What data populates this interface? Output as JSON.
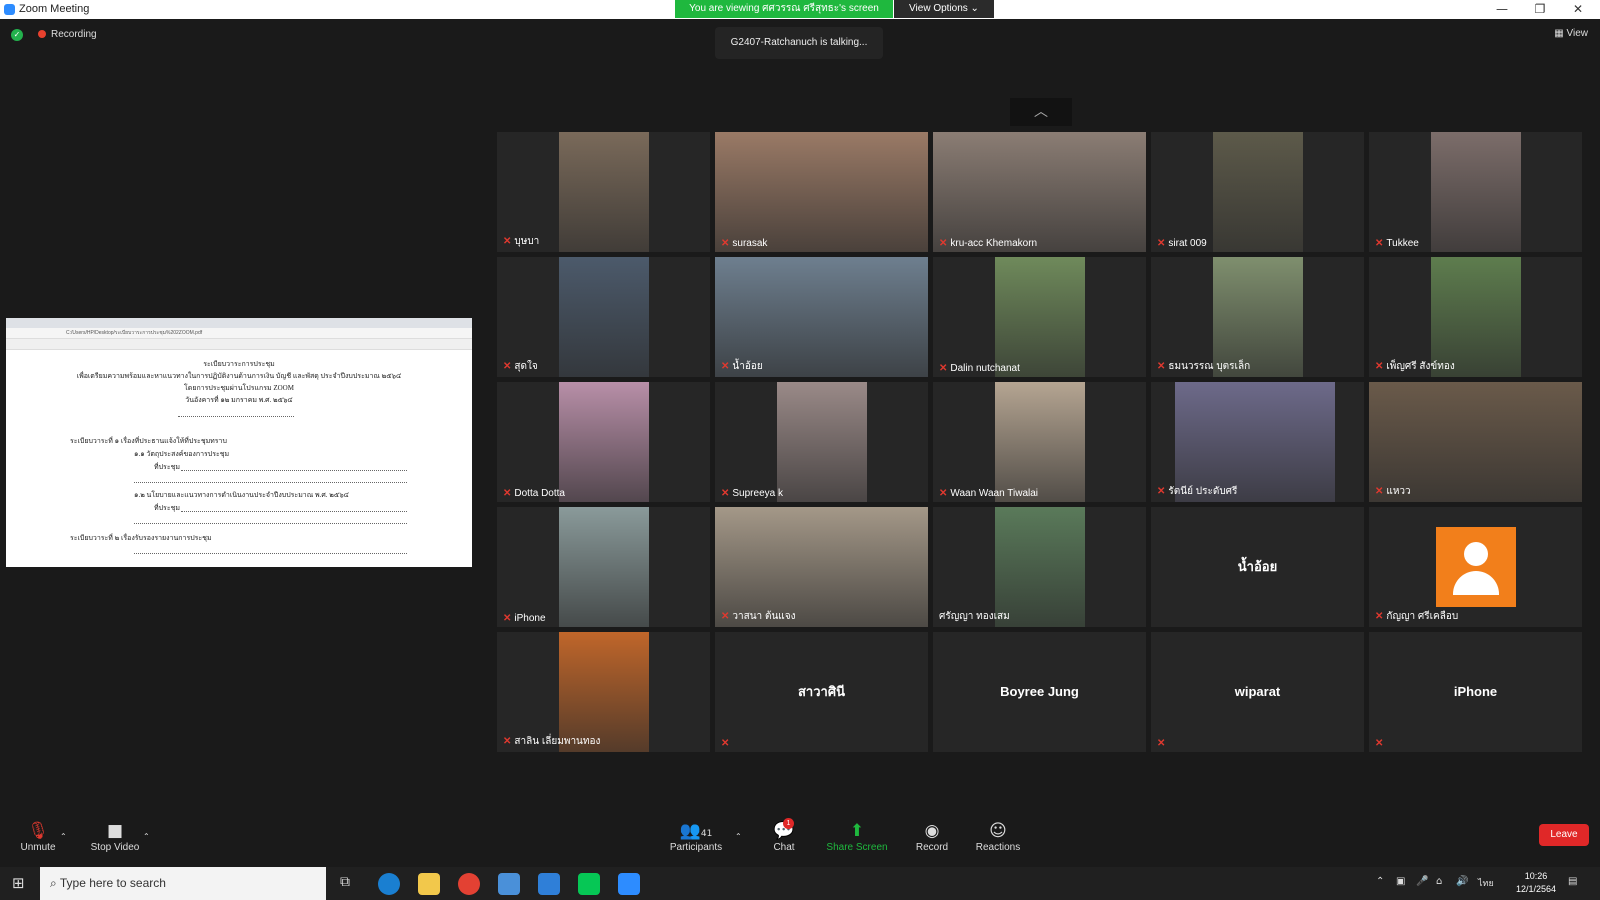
{
  "window": {
    "title": "Zoom Meeting",
    "minimize": "—",
    "restore": "❐",
    "close": "✕"
  },
  "banner": {
    "viewing_text": "You are viewing ศศวรรณ ศรีสุทธะ's screen",
    "view_options": "View Options ⌄"
  },
  "status": {
    "recording": "Recording",
    "talking": "G2407-Ratchanuch is talking...",
    "view_button": "View"
  },
  "shared_doc": {
    "path": "C:/Users/HP/Desktop/ระเบียบวาระการประชุม%202ZOOM.pdf",
    "heading1": "ระเบียบวาระการประชุม",
    "heading2": "เพื่อเตรียมความพร้อมและหาแนวทางในการปฏิบัติงานด้านการเงิน บัญชี และพัสดุ ประจำปีงบประมาณ ๒๕๖๔",
    "heading3": "โดยการประชุมผ่านโปรแกรม ZOOM",
    "heading4": "วันอังคารที่  ๑๒  มกราคม  พ.ศ. ๒๕๖๔",
    "agenda1": "ระเบียบวาระที่  ๑        เรื่องที่ประธานแจ้งให้ที่ประชุมทราบ",
    "agenda1_1": "๑.๑   วัตถุประสงค์ของการประชุม",
    "agenda1_1b": "ที่ประชุม",
    "agenda1_2": "๑.๒   นโยบายและแนวทางการดำเนินงานประจำปีงบประมาณ  พ.ศ. ๒๕๖๔",
    "agenda1_2b": "ที่ประชุม",
    "agenda2": "ระเบียบวาระที่  ๒        เรื่องรับรองรายงานการประชุม"
  },
  "participants": [
    {
      "name": "บุษบา",
      "muted": true,
      "video": true
    },
    {
      "name": "surasak",
      "muted": true,
      "video": true
    },
    {
      "name": "kru-acc Khemakorn",
      "muted": true,
      "video": true
    },
    {
      "name": "sirat 009",
      "muted": true,
      "video": true
    },
    {
      "name": "Tukkee",
      "muted": true,
      "video": true
    },
    {
      "name": "สุดใจ",
      "muted": true,
      "video": true
    },
    {
      "name": "น้ำอ้อย",
      "muted": true,
      "video": true
    },
    {
      "name": "Dalin nutchanat",
      "muted": true,
      "video": true
    },
    {
      "name": "ธมนวรรณ บุตรเล็ก",
      "muted": true,
      "video": true
    },
    {
      "name": "เพ็ญศรี สังข์ทอง",
      "muted": true,
      "video": true
    },
    {
      "name": "Dotta Dotta",
      "muted": true,
      "video": true
    },
    {
      "name": "Supreeya k",
      "muted": true,
      "video": true
    },
    {
      "name": "Waan Waan Tiwalai",
      "muted": true,
      "video": true
    },
    {
      "name": "รัตนีย์ ประดับศรี",
      "muted": true,
      "video": true
    },
    {
      "name": "แหวว",
      "muted": true,
      "video": true
    },
    {
      "name": "iPhone",
      "muted": true,
      "video": true
    },
    {
      "name": "วาสนา ต้นแจง",
      "muted": true,
      "video": true
    },
    {
      "name": "ศรัญญา ทองเสม",
      "muted": false,
      "video": true
    },
    {
      "name": "น้ำอ้อย",
      "muted": false,
      "video": false,
      "label_only": true
    },
    {
      "name": "กัญญา ศรีเคลือบ",
      "muted": true,
      "video": false,
      "avatar": true
    },
    {
      "name": "สาลิน เลี่ยมพานทอง",
      "muted": true,
      "video": true
    },
    {
      "name": "สาวาศินี",
      "muted": true,
      "video": false,
      "label_only": true
    },
    {
      "name": "Boyree Jung",
      "muted": false,
      "video": false,
      "label_only": true
    },
    {
      "name": "wiparat",
      "muted": true,
      "video": false,
      "label_only": true
    },
    {
      "name": "iPhone",
      "muted": true,
      "video": false,
      "label_only": true
    }
  ],
  "toolbar": {
    "unmute": "Unmute",
    "stop_video": "Stop Video",
    "participants": "Participants",
    "participants_count": "41",
    "chat": "Chat",
    "chat_badge": "1",
    "share_screen": "Share Screen",
    "record": "Record",
    "reactions": "Reactions",
    "leave": "Leave"
  },
  "taskbar": {
    "search_placeholder": "Type here to search",
    "lang": "ไทย",
    "time": "10:26",
    "date": "12/1/2564",
    "notify": "1"
  },
  "colors": {
    "accent_green": "#1fb83e",
    "leave_red": "#e02828",
    "zoom_blue": "#2d8cff",
    "avatar_orange": "#f27f1b"
  }
}
